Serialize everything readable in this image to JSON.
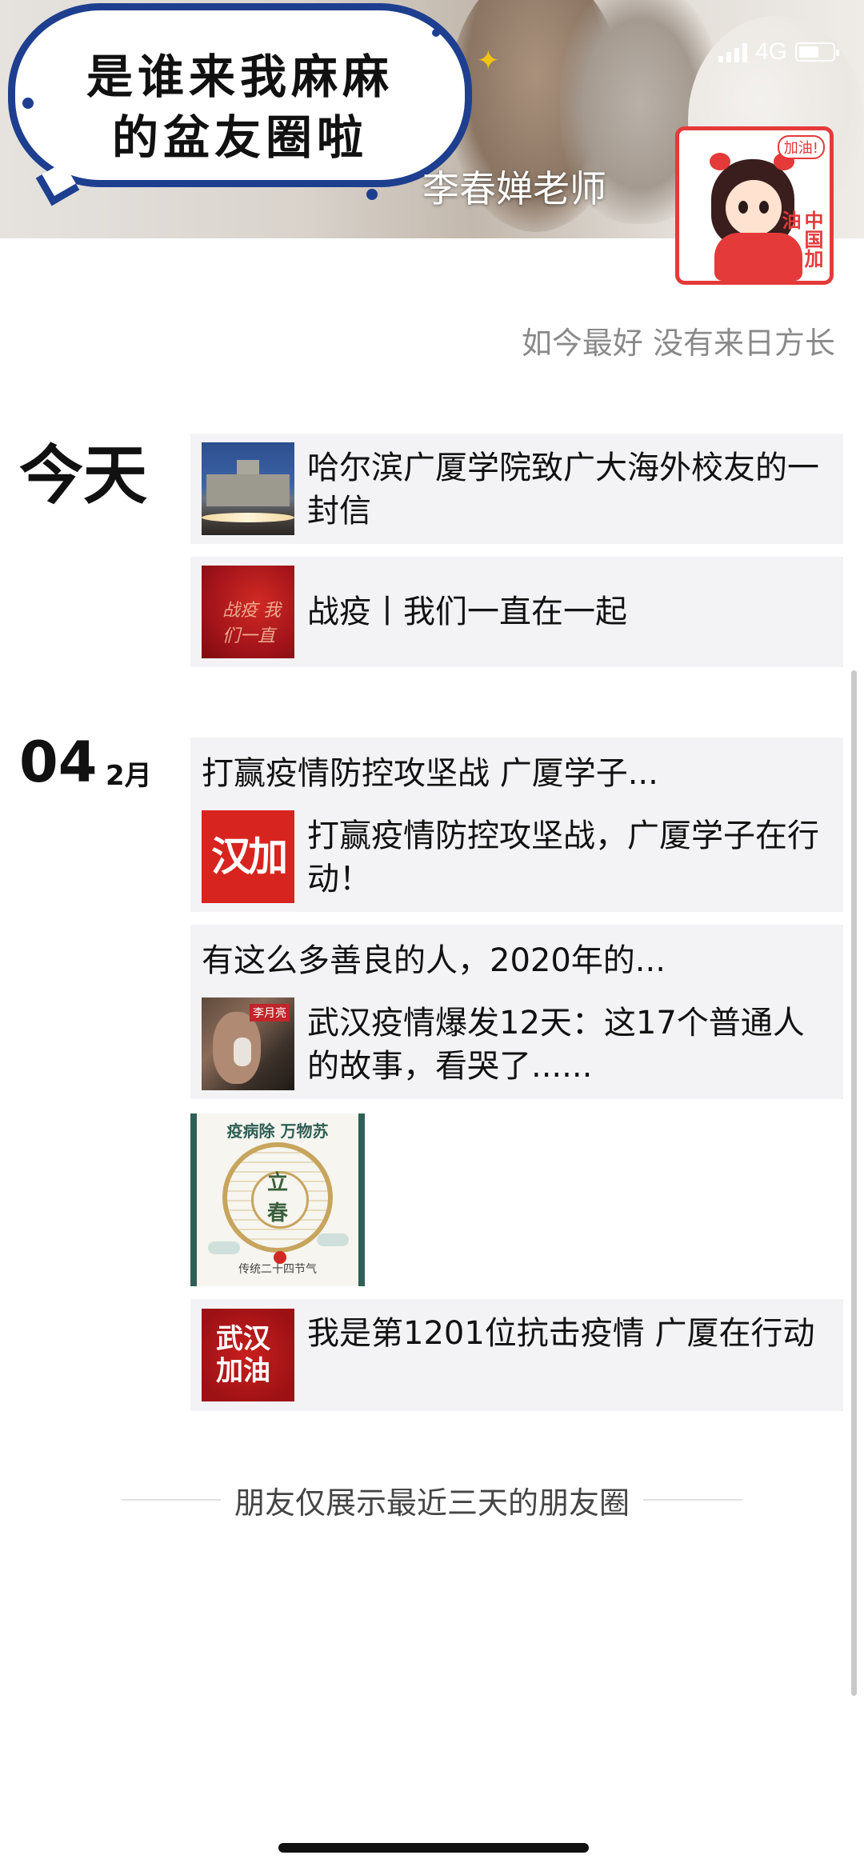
{
  "status_bar": {
    "network": "4G"
  },
  "cover": {
    "bubble_line1": "是谁来我麻麻",
    "bubble_line2": "的盆友圈啦",
    "username": "李春婵老师",
    "avatar_badge": "加油!",
    "avatar_slogan": "中国加油"
  },
  "signature": "如今最好 没有来日方长",
  "sections": [
    {
      "label": "今天",
      "posts": [
        {
          "title": "哈尔滨广厦学院致广大海外校友的一封信",
          "thumb": "campus-building-photo"
        },
        {
          "title": "战疫丨我们一直在一起",
          "thumb": "red-calligraphy-banner",
          "thumb_text": "战疫 我们一直"
        }
      ]
    },
    {
      "day": "04",
      "month": "2月",
      "posts": [
        {
          "headline": "打赢疫情防控攻坚战 广厦学子...",
          "title": "打赢疫情防控攻坚战，广厦学子在行动！",
          "thumb_text": "汉加"
        },
        {
          "headline": "有这么多善良的人，2020年的...",
          "title": "武汉疫情爆发12天：这17个普通人的故事，看哭了......",
          "thumb_tag": "李月亮"
        },
        {
          "image": {
            "top_text": "疫病除 万物苏",
            "char1": "立",
            "char2": "春",
            "caption": "传统二十四节气"
          }
        },
        {
          "title": "我是第1201位抗击疫情 广厦在行动",
          "thumb_text_1": "武汉",
          "thumb_text_2": "加油"
        }
      ]
    }
  ],
  "footer_note": "朋友仅展示最近三天的朋友圈",
  "colors": {
    "accent_blue": "#1e3f8f",
    "red": "#d8241f",
    "card_bg": "#f3f3f5",
    "muted": "#8a8a8a"
  }
}
